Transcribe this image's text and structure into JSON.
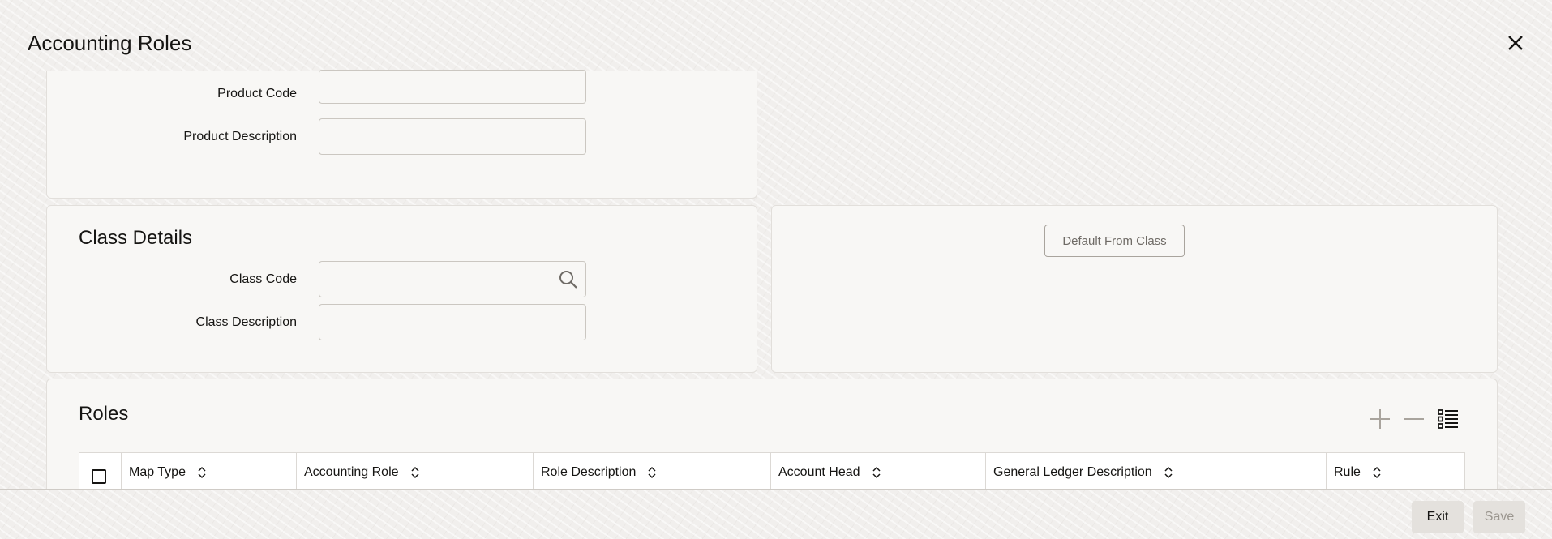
{
  "window": {
    "title": "Accounting Roles"
  },
  "product": {
    "code_label": "Product Code",
    "code_value": "",
    "description_label": "Product Description",
    "description_value": ""
  },
  "class_details": {
    "title": "Class Details",
    "code_label": "Class Code",
    "code_value": "",
    "description_label": "Class Description",
    "description_value": ""
  },
  "default_from_class_label": "Default From Class",
  "roles": {
    "title": "Roles",
    "columns": [
      "Map Type",
      "Accounting Role",
      "Role Description",
      "Account Head",
      "General Ledger Description",
      "Rule"
    ]
  },
  "footer": {
    "exit_label": "Exit",
    "save_label": "Save"
  },
  "icons": {
    "close": "close-icon",
    "search": "search-icon",
    "add": "plus-icon",
    "remove": "minus-icon",
    "details": "list-details-icon",
    "sort": "sort-icon"
  },
  "colors": {
    "text": "#161513",
    "disabled_text": "#9b968f",
    "border": "#cbc7c1"
  }
}
